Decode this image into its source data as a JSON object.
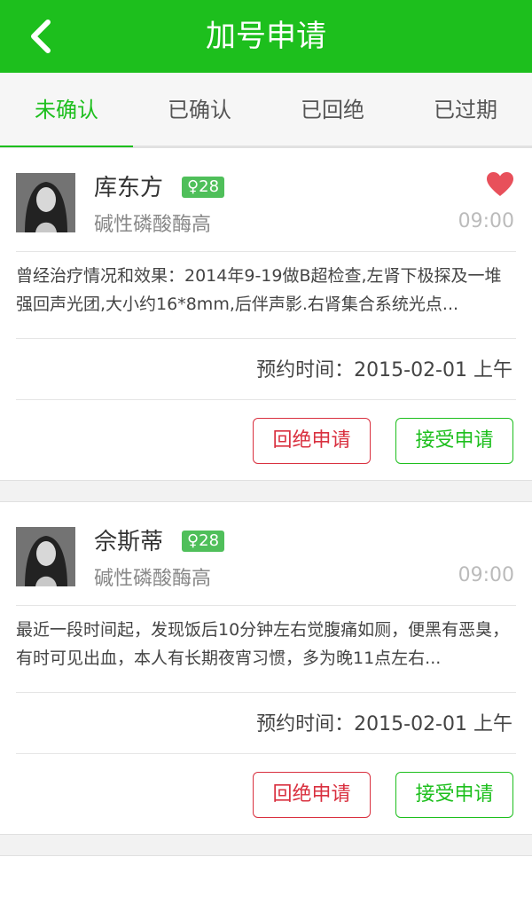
{
  "header": {
    "title": "加号申请"
  },
  "tabs": [
    {
      "label": "未确认",
      "active": true
    },
    {
      "label": "已确认",
      "active": false
    },
    {
      "label": "已回绝",
      "active": false
    },
    {
      "label": "已过期",
      "active": false
    }
  ],
  "requests": [
    {
      "name": "库东方",
      "gender_age": "♀28",
      "diagnosis": "碱性磷酸酶高",
      "time": "09:00",
      "favorited": true,
      "description": "曾经治疗情况和效果：2014年9-19做B超检查,左肾下极探及一堆强回声光团,大小约16*8mm,后伴声影.右肾集合系统光点...",
      "appointment_label": "预约时间：",
      "appointment_value": "2015-02-01 上午",
      "reject_label": "回绝申请",
      "accept_label": "接受申请"
    },
    {
      "name": "佘斯蒂",
      "gender_age": "♀28",
      "diagnosis": "碱性磷酸酶高",
      "time": "09:00",
      "favorited": false,
      "description": "最近一段时间起，发现饭后10分钟左右觉腹痛如厕，便黑有恶臭，有时可见出血，本人有长期夜宵习惯，多为晚11点左右...",
      "appointment_label": "预约时间：",
      "appointment_value": "2015-02-01 上午",
      "reject_label": "回绝申请",
      "accept_label": "接受申请"
    }
  ],
  "colors": {
    "brand_green": "#1dbf1d",
    "badge_green": "#4fbf5a",
    "reject_red": "#d9303f",
    "heart_red": "#e8505b"
  },
  "icons": {
    "back": "chevron-left-icon",
    "favorite": "heart-icon"
  }
}
